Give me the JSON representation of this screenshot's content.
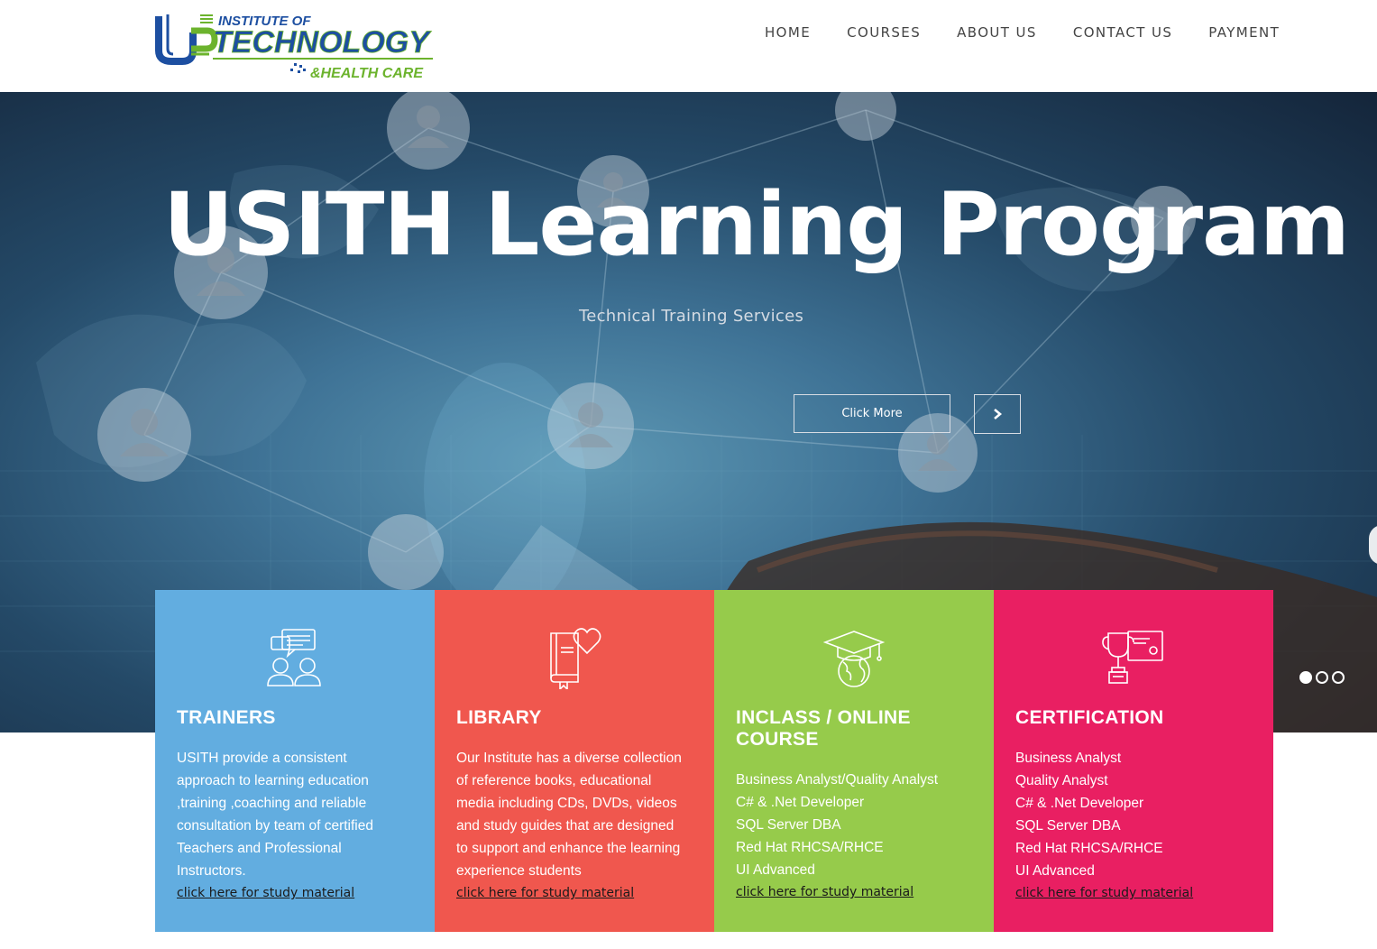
{
  "brand": {
    "logo_line1": "INSTITUTE OF",
    "logo_line2": "TECHNOLOGY",
    "logo_line3": "&HEALTH CARE",
    "logo_mark": "US",
    "colors": {
      "blue": "#1d4fa1",
      "green": "#6cb32d"
    }
  },
  "nav": {
    "items": [
      {
        "label": "HOME"
      },
      {
        "label": "COURSES"
      },
      {
        "label": "ABOUT US"
      },
      {
        "label": "CONTACT US"
      },
      {
        "label": "PAYMENT"
      }
    ]
  },
  "hero": {
    "title": "USITH Learning Program",
    "subtitle": "Technical Training Services",
    "button_label": "Click More",
    "next_icon": "chevron-right-icon",
    "slides": 3,
    "active_slide": 1
  },
  "cards": [
    {
      "title": "TRAINERS",
      "icon": "trainers-chat-icon",
      "color": "#62ade0",
      "lines": [
        "USITH provide a consistent",
        "approach to learning education",
        ",training ,coaching and reliable",
        "consultation by team of certified",
        "Teachers and Professional",
        "Instructors."
      ],
      "link": "click here for study material"
    },
    {
      "title": "LIBRARY",
      "icon": "book-heart-icon",
      "color": "#f0574e",
      "lines": [
        "Our Institute has a diverse collection",
        "of reference books, educational",
        "media including CDs, DVDs, videos",
        "and study guides that are designed",
        "to support and enhance the learning",
        "experience students"
      ],
      "link": "click here for study material"
    },
    {
      "title": "INCLASS / ONLINE COURSE",
      "icon": "graduation-globe-icon",
      "color": "#96cb4b",
      "lines": [
        "Business Analyst/Quality Analyst",
        "C# & .Net Developer",
        "SQL Server DBA",
        "Red Hat RHCSA/RHCE",
        "UI Advanced"
      ],
      "link": "click here for study material"
    },
    {
      "title": "CERTIFICATION",
      "icon": "trophy-certificate-icon",
      "color": "#e91f62",
      "lines": [
        "Business Analyst",
        "Quality Analyst",
        "C# & .Net Developer",
        "SQL Server DBA",
        "Red Hat RHCSA/RHCE",
        "UI Advanced"
      ],
      "link": "click here for study material"
    }
  ]
}
